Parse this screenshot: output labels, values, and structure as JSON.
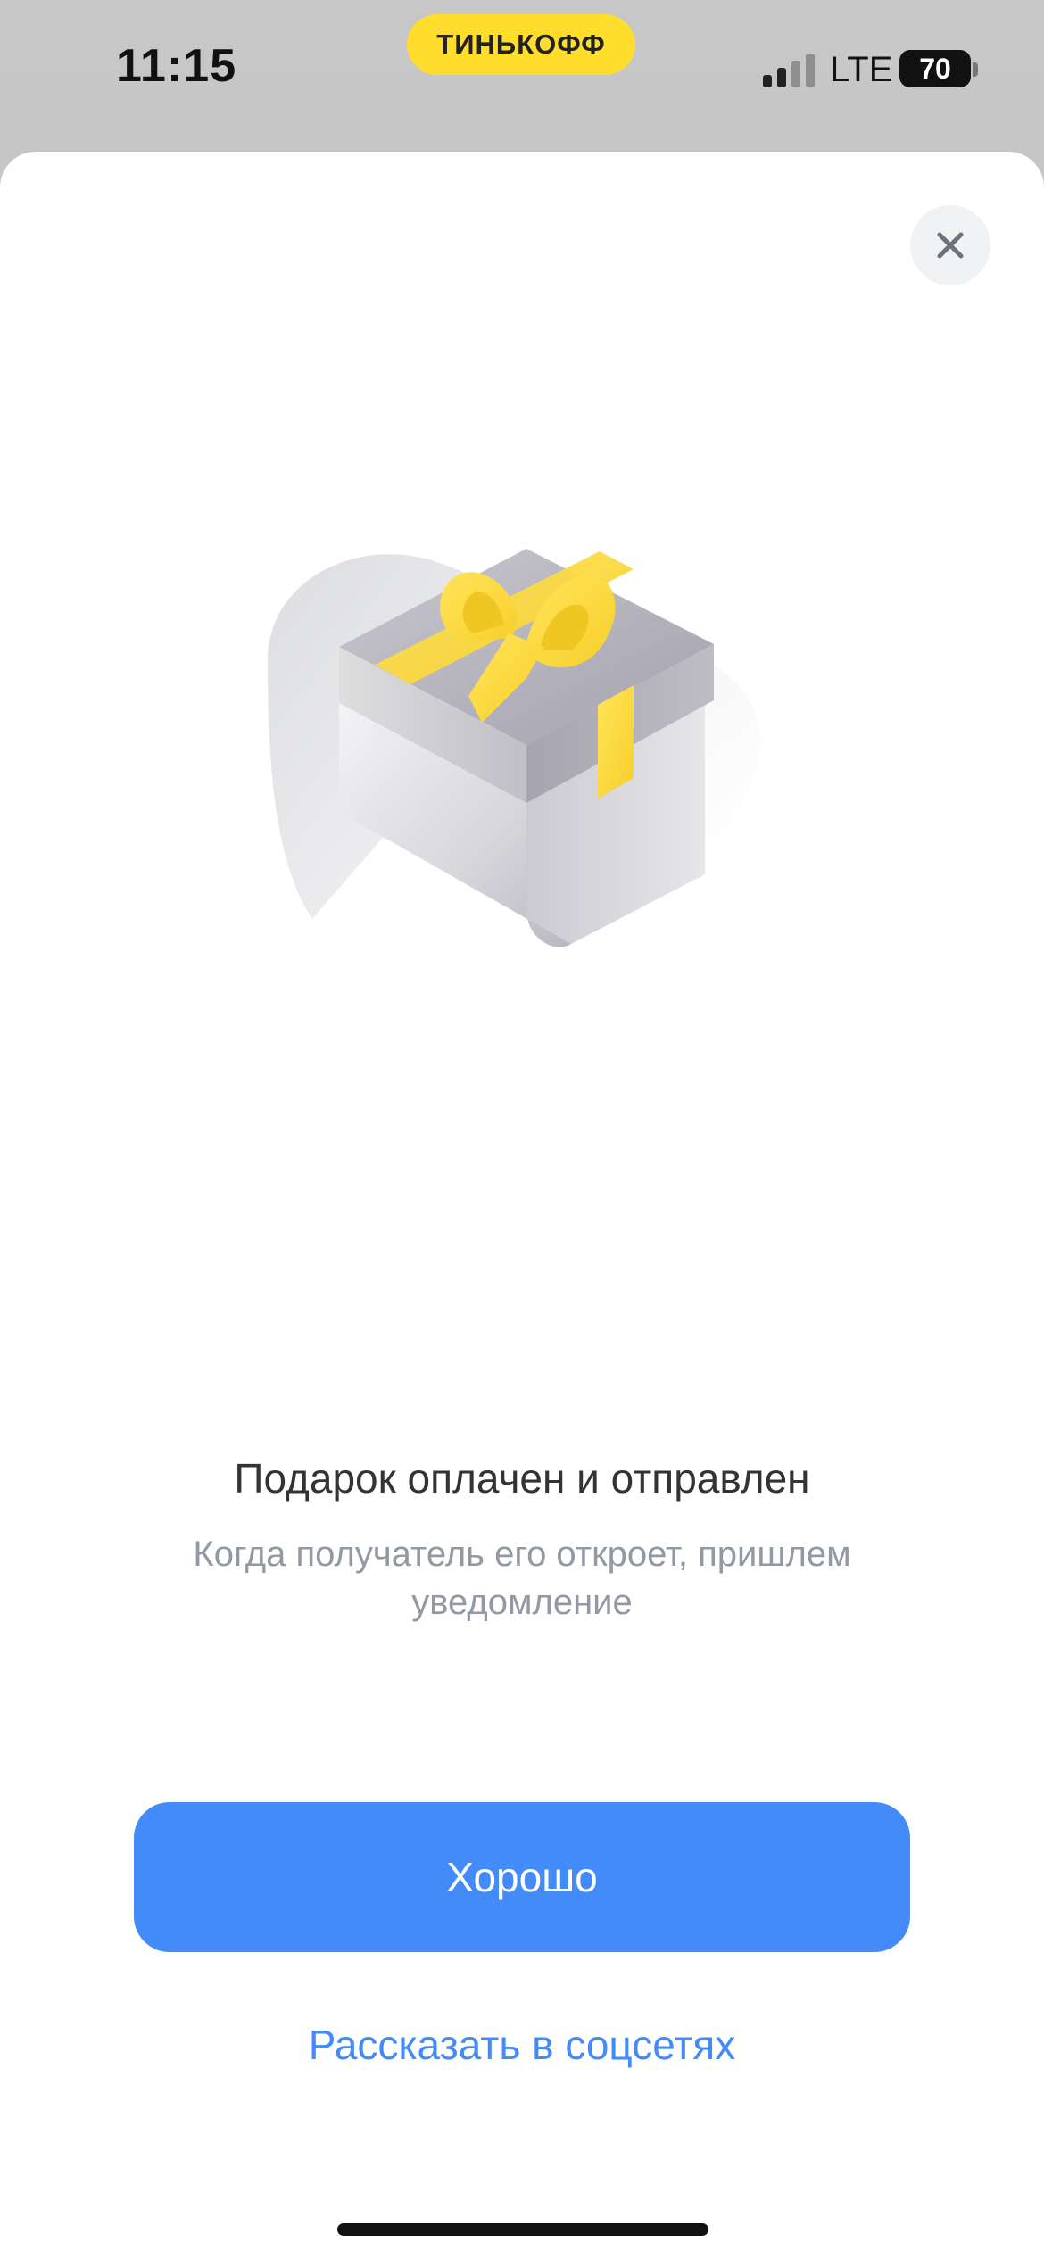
{
  "status_bar": {
    "time": "11:15",
    "brand": "ТИНЬКОФФ",
    "network": "LTE",
    "battery": "70",
    "signal_bars_active": 2,
    "signal_bars_total": 4
  },
  "dialog": {
    "close_icon": "close-icon",
    "illustration": "gift-box-icon",
    "title": "Подарок оплачен и отправлен",
    "subtitle": "Когда получатель его откроет, пришлем уведомление",
    "primary_button": "Хорошо",
    "secondary_link": "Рассказать в соцсетях"
  },
  "colors": {
    "accent": "#428bf9",
    "brand_yellow": "#ffdd2d",
    "subtitle": "#9299a2"
  }
}
